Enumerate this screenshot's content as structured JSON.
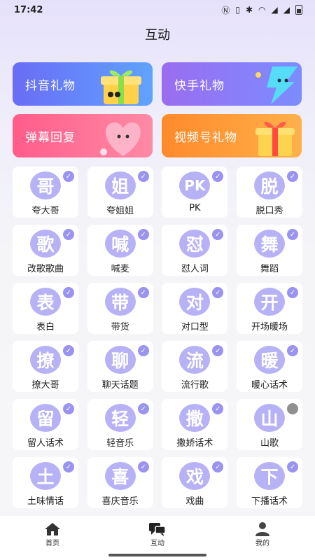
{
  "status": {
    "time": "17:42"
  },
  "header": {
    "title": "互动"
  },
  "banners": [
    {
      "label": "抖音礼物"
    },
    {
      "label": "快手礼物"
    },
    {
      "label": "弹幕回复"
    },
    {
      "label": "视频号礼物"
    }
  ],
  "tiles": [
    {
      "glyph": "哥",
      "label": "夸大哥",
      "checked": true
    },
    {
      "glyph": "姐",
      "label": "夸姐姐",
      "checked": true
    },
    {
      "glyph": "PK",
      "label": "PK",
      "checked": true
    },
    {
      "glyph": "脱",
      "label": "脱口秀",
      "checked": true
    },
    {
      "glyph": "歌",
      "label": "改歌歌曲",
      "checked": true
    },
    {
      "glyph": "喊",
      "label": "喊麦",
      "checked": true
    },
    {
      "glyph": "怼",
      "label": "怼人词",
      "checked": true
    },
    {
      "glyph": "舞",
      "label": "舞蹈",
      "checked": true
    },
    {
      "glyph": "表",
      "label": "表白",
      "checked": true
    },
    {
      "glyph": "带",
      "label": "带货",
      "checked": true
    },
    {
      "glyph": "对",
      "label": "对口型",
      "checked": true
    },
    {
      "glyph": "开",
      "label": "开场暖场",
      "checked": true
    },
    {
      "glyph": "撩",
      "label": "撩大哥",
      "checked": true
    },
    {
      "glyph": "聊",
      "label": "聊天话题",
      "checked": true
    },
    {
      "glyph": "流",
      "label": "流行歌",
      "checked": true
    },
    {
      "glyph": "暖",
      "label": "暖心话术",
      "checked": true
    },
    {
      "glyph": "留",
      "label": "留人话术",
      "checked": true
    },
    {
      "glyph": "轻",
      "label": "轻音乐",
      "checked": true
    },
    {
      "glyph": "撒",
      "label": "撒娇话术",
      "checked": true
    },
    {
      "glyph": "山",
      "label": "山歌",
      "checked": false
    },
    {
      "glyph": "土",
      "label": "土味情话",
      "checked": true
    },
    {
      "glyph": "喜",
      "label": "喜庆音乐",
      "checked": true
    },
    {
      "glyph": "戏",
      "label": "戏曲",
      "checked": true
    },
    {
      "glyph": "下",
      "label": "下播话术",
      "checked": true
    }
  ],
  "tabbar": {
    "items": [
      {
        "label": "首页",
        "icon": "home-icon"
      },
      {
        "label": "互动",
        "icon": "chat-icon"
      },
      {
        "label": "我的",
        "icon": "person-icon"
      }
    ]
  },
  "colors": {
    "accent": "#b7b1f6",
    "check": "#9a93ef",
    "check_off": "#8f8f8f"
  }
}
